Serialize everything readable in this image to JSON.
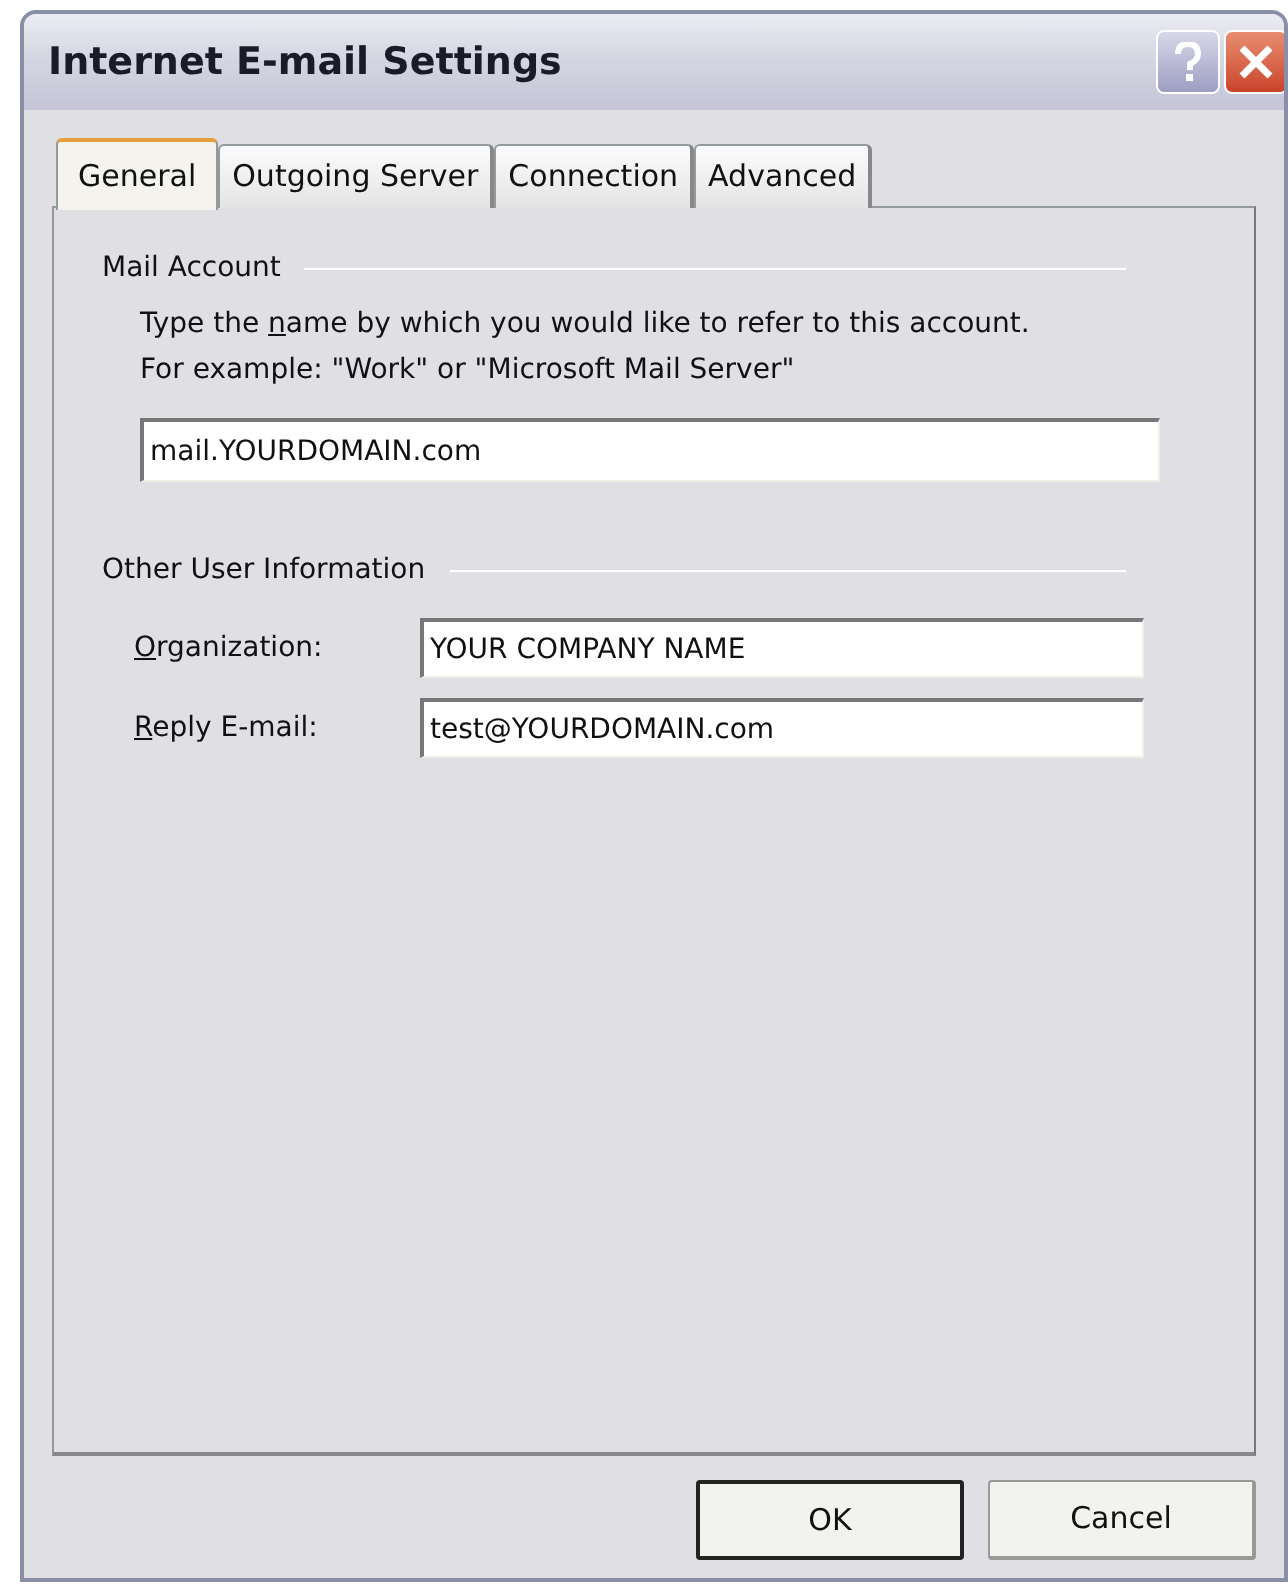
{
  "window": {
    "title": "Internet E-mail Settings"
  },
  "tabs": [
    {
      "label": "General",
      "selected": true
    },
    {
      "label": "Outgoing Server",
      "selected": false
    },
    {
      "label": "Connection",
      "selected": false
    },
    {
      "label": "Advanced",
      "selected": false
    }
  ],
  "mail_account": {
    "heading": "Mail Account",
    "description": {
      "before": "Type the ",
      "access_key": "n",
      "after": "ame by which you would like to refer to this account.  For example: \"Work\" or \"Microsoft Mail Server\""
    },
    "value": "mail.YOURDOMAIN.com"
  },
  "other_user_information": {
    "heading": "Other User Information",
    "fields": [
      {
        "label": {
          "access_key": "O",
          "after": "rganization:"
        },
        "value": "YOUR COMPANY NAME"
      },
      {
        "label": {
          "access_key": "R",
          "after": "eply E-mail:"
        },
        "value": "test@YOURDOMAIN.com"
      }
    ]
  },
  "buttons": [
    {
      "label": "OK",
      "default": true
    },
    {
      "label": "Cancel",
      "default": false
    }
  ]
}
